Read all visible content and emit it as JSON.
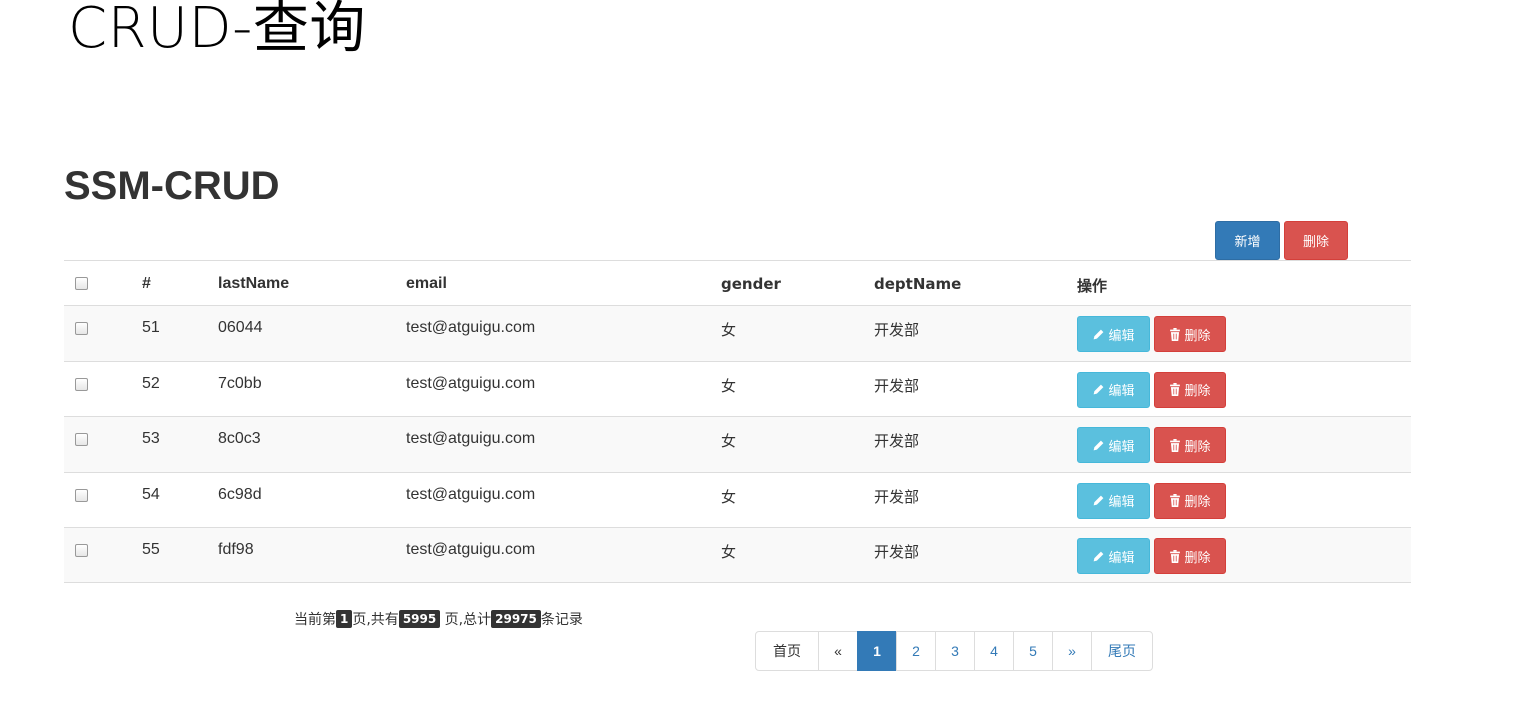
{
  "slide_title": "CRUD-查询",
  "app_title": "SSM-CRUD",
  "toolbar": {
    "add_label": "新增",
    "delete_label": "删除"
  },
  "table": {
    "headers": {
      "id": "#",
      "last_name": "lastName",
      "email": "email",
      "gender": "gender",
      "dept_name": "deptName",
      "operations": "操作"
    },
    "rows": [
      {
        "id": "51",
        "last_name": "06044",
        "email": "test@atguigu.com",
        "gender": "女",
        "dept_name": "开发部"
      },
      {
        "id": "52",
        "last_name": "7c0bb",
        "email": "test@atguigu.com",
        "gender": "女",
        "dept_name": "开发部"
      },
      {
        "id": "53",
        "last_name": "8c0c3",
        "email": "test@atguigu.com",
        "gender": "女",
        "dept_name": "开发部"
      },
      {
        "id": "54",
        "last_name": "6c98d",
        "email": "test@atguigu.com",
        "gender": "女",
        "dept_name": "开发部"
      },
      {
        "id": "55",
        "last_name": "fdf98",
        "email": "test@atguigu.com",
        "gender": "女",
        "dept_name": "开发部"
      }
    ],
    "edit_label": "编辑",
    "delete_label": "删除"
  },
  "page_info": {
    "prefix": "当前第",
    "current_page": "1",
    "middle1": "页,共有",
    "total_pages": "5995",
    "middle2": " 页,总计",
    "total_records": "29975",
    "suffix": "条记录"
  },
  "pagination": {
    "first": "首页",
    "prev": "«",
    "pages": [
      "1",
      "2",
      "3",
      "4",
      "5"
    ],
    "active_page": "1",
    "next": "»",
    "last": "尾页"
  },
  "colors": {
    "primary": "#337ab7",
    "danger": "#d9534f",
    "info": "#5bc0de",
    "badge": "#333333"
  },
  "icons": {
    "edit": "pencil-icon",
    "delete": "trash-icon"
  }
}
